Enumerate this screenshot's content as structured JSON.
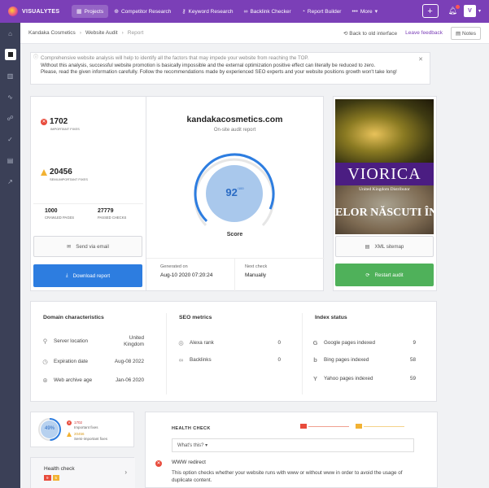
{
  "app": {
    "name": "VISUALYTES"
  },
  "nav": {
    "projects": "Projects",
    "competitor": "Competitor Research",
    "keyword": "Keyword Research",
    "backlink": "Backlink Checker",
    "report": "Report Builder",
    "more": "More"
  },
  "user": {
    "initial": "V"
  },
  "breadcrumb": {
    "c1": "Kandaka Cosmetics",
    "c2": "Website Audit",
    "c3": "Report"
  },
  "actions": {
    "back": "Back to old interface",
    "feedback": "Leave feedback",
    "notes": "Notes"
  },
  "notice": {
    "line1": "Comprehensive website analysis will help to identify all the factors that may impede your website from reaching the TOP.",
    "line2": "Without this analysis, successful website promotion is basically impossible and the external optimization positive effect can literally be reduced to zero.",
    "line3": "Please, read the given information carefully. Follow the recommendations made by experienced SEO experts and your website positions growth won't take long!"
  },
  "stats": {
    "important": "1702",
    "important_label": "Important fixes",
    "semi": "20456",
    "semi_label": "Semi-important fixes",
    "crawled": "1000",
    "crawled_label": "Crawled pages",
    "passed": "27779",
    "passed_label": "Passed checks"
  },
  "buttons": {
    "email": "Send via email",
    "download": "Download report",
    "sitemap": "XML sitemap",
    "restart": "Restart audit"
  },
  "audit": {
    "domain": "kandakacosmetics.com",
    "subtitle": "On-site audit report",
    "score": "92",
    "score_max": "/100",
    "score_value": 92,
    "score_label": "Score",
    "generated_label": "Generated on",
    "generated": "Aug-10 2020 07:20:24",
    "next_label": "Next check",
    "next": "Manually"
  },
  "ad": {
    "brand": "VIORICA",
    "dist": "United Kingdom Distributor",
    "tagline": "ELOR NĂSCUTI ÎN"
  },
  "domain_chars": {
    "title": "Domain characteristics",
    "rows": [
      {
        "label": "Server location",
        "value1": "United",
        "value2": "Kingdom"
      },
      {
        "label": "Expiration date",
        "value": "Aug-08 2022"
      },
      {
        "label": "Web archive age",
        "value": "Jan-06 2020"
      }
    ]
  },
  "seo": {
    "title": "SEO metrics",
    "rows": [
      {
        "label": "Alexa rank",
        "value": "0"
      },
      {
        "label": "Backlinks",
        "value": "0"
      }
    ]
  },
  "index": {
    "title": "Index status",
    "rows": [
      {
        "label": "Google pages indexed",
        "value": "9"
      },
      {
        "label": "Bing pages indexed",
        "value": "58"
      },
      {
        "label": "Yahoo pages indexed",
        "value": "59"
      }
    ]
  },
  "mini": {
    "pct": "49%",
    "pct_value": 49,
    "imp": "1702",
    "imp_lbl": "Important fixes",
    "semi": "20456",
    "semi_lbl": "Semi-important fixes"
  },
  "healthnav": {
    "label": "Health check",
    "c1": "9",
    "c2": "5"
  },
  "health": {
    "title": "HEALTH CHECK",
    "select": "What's this?",
    "item_title": "WWW redirect",
    "desc1": "This option checks whether your website runs with www or without www in order to avoid the usage of",
    "desc2": "duplicate content."
  }
}
